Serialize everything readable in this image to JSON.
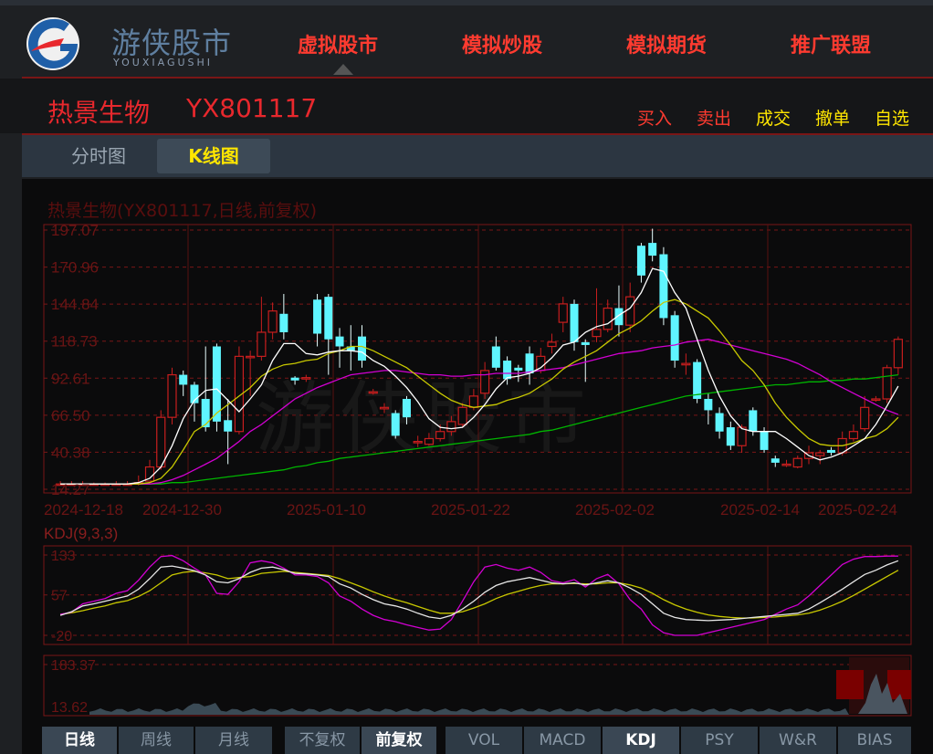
{
  "colors": {
    "nav_red": "#ff3b30",
    "stock_red": "#e8282d",
    "buy_red": "#ff3b30",
    "yellow": "#ffe600",
    "up": "#c81e1e",
    "down": "#5ff5ff",
    "ma5": "#ffffff",
    "ma10": "#c8c800",
    "ma20": "#d200d2",
    "ma60": "#00b400"
  },
  "logo": {
    "name": "游侠股市",
    "sub": "YOUXIAGUSHI",
    "icon": "g-swirl-logo-icon"
  },
  "nav": [
    "虚拟股市",
    "模拟炒股",
    "模拟期货",
    "推广联盟"
  ],
  "stock": {
    "name": "热景生物",
    "code": "YX801117"
  },
  "actions": {
    "buy": "买入",
    "sell": "卖出",
    "deal": "成交",
    "cancel": "撤单",
    "watch": "自选"
  },
  "tabs": {
    "minute": "分时图",
    "kline": "K线图"
  },
  "watermark": "游侠股市",
  "chart_title": "热景生物(YX801117,日线,前复权)",
  "kdj_title": "KDJ(9,3,3)",
  "chart_data": {
    "type": "candlestick",
    "title": "热景生物(YX801117,日线,前复权)",
    "y_ticks": [
      "197.07",
      "170.96",
      "144.84",
      "118.73",
      "92.61",
      "66.50",
      "40.38",
      "14.27"
    ],
    "x_ticks": [
      "2024-12-18",
      "2024-12-30",
      "2025-01-10",
      "2025-01-22",
      "2025-02-02",
      "2025-02-14",
      "2025-02-24"
    ],
    "ylim": [
      14.27,
      197.07
    ],
    "candles": [
      [
        18,
        18,
        20,
        17
      ],
      [
        18,
        18,
        20,
        17
      ],
      [
        18,
        18,
        20,
        17
      ],
      [
        18,
        18,
        19,
        17
      ],
      [
        18,
        18,
        19,
        17
      ],
      [
        18,
        18,
        20,
        17
      ],
      [
        18,
        18,
        20,
        17
      ],
      [
        18,
        19,
        24,
        17
      ],
      [
        20,
        30,
        35,
        20
      ],
      [
        30,
        65,
        70,
        28
      ],
      [
        65,
        95,
        100,
        60
      ],
      [
        95,
        88,
        98,
        80
      ],
      [
        88,
        75,
        90,
        62
      ],
      [
        78,
        58,
        115,
        55
      ],
      [
        115,
        62,
        117,
        55
      ],
      [
        63,
        55,
        78,
        32
      ],
      [
        55,
        108,
        115,
        53
      ],
      [
        108,
        108,
        112,
        80
      ],
      [
        108,
        125,
        150,
        105
      ],
      [
        125,
        140,
        146,
        120
      ],
      [
        138,
        125,
        152,
        120
      ],
      [
        93,
        91,
        94,
        88
      ],
      [
        93,
        93,
        95,
        90
      ],
      [
        148,
        124,
        152,
        115
      ],
      [
        150,
        120,
        152,
        95
      ],
      [
        122,
        115,
        128,
        100
      ],
      [
        115,
        112,
        130,
        98
      ],
      [
        122,
        105,
        130,
        100
      ],
      [
        83,
        83,
        85,
        81
      ],
      [
        71,
        72,
        75,
        68
      ],
      [
        68,
        52,
        70,
        50
      ],
      [
        78,
        65,
        80,
        60
      ],
      [
        48,
        48,
        52,
        44
      ],
      [
        46,
        50,
        54,
        45
      ],
      [
        50,
        55,
        60,
        48
      ],
      [
        55,
        62,
        66,
        52
      ],
      [
        60,
        72,
        75,
        58
      ],
      [
        72,
        80,
        85,
        70
      ],
      [
        82,
        98,
        104,
        78
      ],
      [
        115,
        100,
        122,
        98
      ],
      [
        105,
        92,
        108,
        88
      ],
      [
        100,
        98,
        102,
        90
      ],
      [
        110,
        96,
        115,
        88
      ],
      [
        98,
        108,
        114,
        96
      ],
      [
        115,
        118,
        124,
        110
      ],
      [
        132,
        145,
        150,
        125
      ],
      [
        145,
        118,
        148,
        112
      ],
      [
        118,
        116,
        120,
        90
      ],
      [
        122,
        127,
        156,
        118
      ],
      [
        127,
        142,
        148,
        125
      ],
      [
        142,
        130,
        158,
        122
      ],
      [
        130,
        150,
        160,
        125
      ],
      [
        186,
        165,
        188,
        160
      ],
      [
        188,
        179,
        198,
        175
      ],
      [
        180,
        135,
        185,
        130
      ],
      [
        137,
        105,
        140,
        100
      ],
      [
        102,
        103,
        110,
        95
      ],
      [
        104,
        78,
        106,
        75
      ],
      [
        78,
        70,
        82,
        60
      ],
      [
        68,
        55,
        72,
        50
      ],
      [
        58,
        45,
        62,
        42
      ],
      [
        45,
        58,
        60,
        40
      ],
      [
        70,
        55,
        72,
        52
      ],
      [
        55,
        42,
        58,
        40
      ],
      [
        36,
        33,
        38,
        30
      ],
      [
        32,
        32,
        35,
        30
      ],
      [
        30,
        36,
        38,
        29
      ],
      [
        36,
        40,
        45,
        32
      ],
      [
        38,
        40,
        42,
        32
      ],
      [
        42,
        40,
        44,
        38
      ],
      [
        40,
        50,
        55,
        38
      ],
      [
        50,
        55,
        60,
        48
      ],
      [
        57,
        72,
        80,
        55
      ],
      [
        78,
        78,
        80,
        76
      ],
      [
        78,
        100,
        102,
        75
      ],
      [
        100,
        120,
        122,
        95
      ]
    ],
    "ma5": [
      18,
      18,
      18,
      18,
      18,
      18,
      18,
      19,
      22,
      30,
      45,
      64,
      77,
      84,
      85,
      77,
      69,
      78,
      88,
      105,
      117,
      117,
      110,
      109,
      111,
      112,
      112,
      111,
      105,
      101,
      94,
      86,
      76,
      64,
      58,
      57,
      58,
      65,
      74,
      85,
      93,
      94,
      96,
      100,
      107,
      116,
      118,
      125,
      129,
      131,
      137,
      142,
      153,
      170,
      168,
      153,
      142,
      120,
      98,
      80,
      66,
      57,
      55,
      55,
      55,
      50,
      44,
      38,
      35,
      37,
      40,
      45,
      50,
      60,
      73,
      87
    ],
    "ma10": [
      18,
      18,
      18,
      18,
      18,
      18,
      18,
      18,
      19,
      22,
      30,
      42,
      55,
      60,
      68,
      74,
      80,
      86,
      94,
      99,
      102,
      103,
      105,
      106,
      110,
      112,
      115,
      115,
      112,
      108,
      104,
      100,
      94,
      88,
      82,
      77,
      74,
      72,
      73,
      74,
      77,
      79,
      82,
      87,
      92,
      99,
      104,
      108,
      112,
      118,
      124,
      128,
      133,
      140,
      146,
      148,
      145,
      140,
      135,
      126,
      116,
      105,
      98,
      88,
      75,
      65,
      57,
      50,
      46,
      45,
      45,
      47,
      50,
      52,
      57,
      65
    ],
    "ma20": [
      18,
      18,
      18,
      18,
      18,
      18,
      18,
      18,
      18,
      19,
      21,
      24,
      28,
      32,
      36,
      42,
      48,
      55,
      60,
      66,
      72,
      78,
      82,
      86,
      89,
      92,
      95,
      96,
      97,
      98,
      98,
      97,
      96,
      95,
      95,
      94,
      94,
      95,
      95,
      96,
      96,
      96,
      97,
      98,
      99,
      100,
      102,
      104,
      106,
      108,
      110,
      111,
      112,
      114,
      115,
      116,
      118,
      119,
      120,
      118,
      116,
      114,
      112,
      110,
      108,
      106,
      103,
      99,
      95,
      90,
      86,
      82,
      78,
      74,
      70,
      67
    ],
    "ma60": [
      18,
      18,
      18,
      18,
      18,
      18,
      18,
      18,
      18,
      18,
      19,
      19,
      20,
      21,
      22,
      23,
      24,
      25,
      26,
      27,
      28,
      30,
      31,
      33,
      34,
      36,
      37,
      38,
      39,
      40,
      41,
      42,
      43,
      44,
      45,
      46,
      47,
      48,
      49,
      50,
      51,
      52,
      53,
      55,
      56,
      58,
      60,
      62,
      64,
      66,
      68,
      70,
      72,
      74,
      76,
      78,
      80,
      81,
      82,
      83,
      84,
      85,
      86,
      87,
      88,
      88,
      89,
      90,
      90,
      91,
      91,
      92,
      92,
      93,
      94,
      95
    ]
  },
  "kdj": {
    "ticks": [
      "133",
      "57",
      "-20"
    ],
    "ylim": [
      -20,
      133
    ],
    "k": [
      18,
      25,
      36,
      40,
      45,
      50,
      55,
      68,
      88,
      110,
      112,
      108,
      103,
      95,
      82,
      80,
      88,
      100,
      108,
      110,
      105,
      98,
      97,
      95,
      92,
      78,
      70,
      58,
      48,
      40,
      36,
      30,
      22,
      15,
      12,
      18,
      30,
      45,
      62,
      75,
      82,
      86,
      90,
      85,
      80,
      78,
      80,
      76,
      80,
      84,
      80,
      70,
      58,
      40,
      22,
      14,
      10,
      9,
      8,
      9,
      10,
      12,
      14,
      16,
      18,
      20,
      22,
      30,
      42,
      55,
      68,
      82,
      96,
      104,
      114,
      122
    ],
    "d": [
      20,
      23,
      27,
      32,
      36,
      42,
      46,
      54,
      65,
      80,
      95,
      100,
      102,
      99,
      95,
      88,
      90,
      92,
      98,
      100,
      102,
      100,
      98,
      96,
      94,
      88,
      80,
      72,
      63,
      55,
      48,
      42,
      35,
      28,
      22,
      22,
      25,
      32,
      40,
      50,
      58,
      64,
      70,
      75,
      78,
      78,
      79,
      78,
      78,
      80,
      80,
      76,
      70,
      60,
      48,
      38,
      30,
      24,
      19,
      16,
      14,
      13,
      13,
      14,
      15,
      17,
      19,
      22,
      28,
      36,
      45,
      56,
      68,
      80,
      92,
      104
    ],
    "j": [
      20,
      24,
      40,
      45,
      50,
      60,
      65,
      85,
      110,
      130,
      132,
      122,
      108,
      95,
      60,
      58,
      82,
      118,
      122,
      118,
      108,
      95,
      95,
      92,
      80,
      55,
      45,
      30,
      18,
      10,
      6,
      0,
      -5,
      -10,
      -8,
      10,
      45,
      82,
      110,
      115,
      108,
      104,
      110,
      100,
      84,
      80,
      86,
      72,
      88,
      96,
      78,
      48,
      30,
      0,
      -15,
      -20,
      -20,
      -20,
      -15,
      -10,
      -5,
      0,
      5,
      10,
      20,
      30,
      38,
      55,
      75,
      95,
      115,
      125,
      130,
      130,
      131,
      131
    ]
  },
  "volume": {
    "ticks": [
      "183.37",
      "13.62"
    ]
  },
  "bottom": {
    "period": [
      "日线",
      "周线",
      "月线"
    ],
    "adjust": [
      "不复权",
      "前复权"
    ],
    "indicators": [
      "VOL",
      "MACD",
      "KDJ",
      "PSY",
      "W&R",
      "BIAS"
    ]
  }
}
